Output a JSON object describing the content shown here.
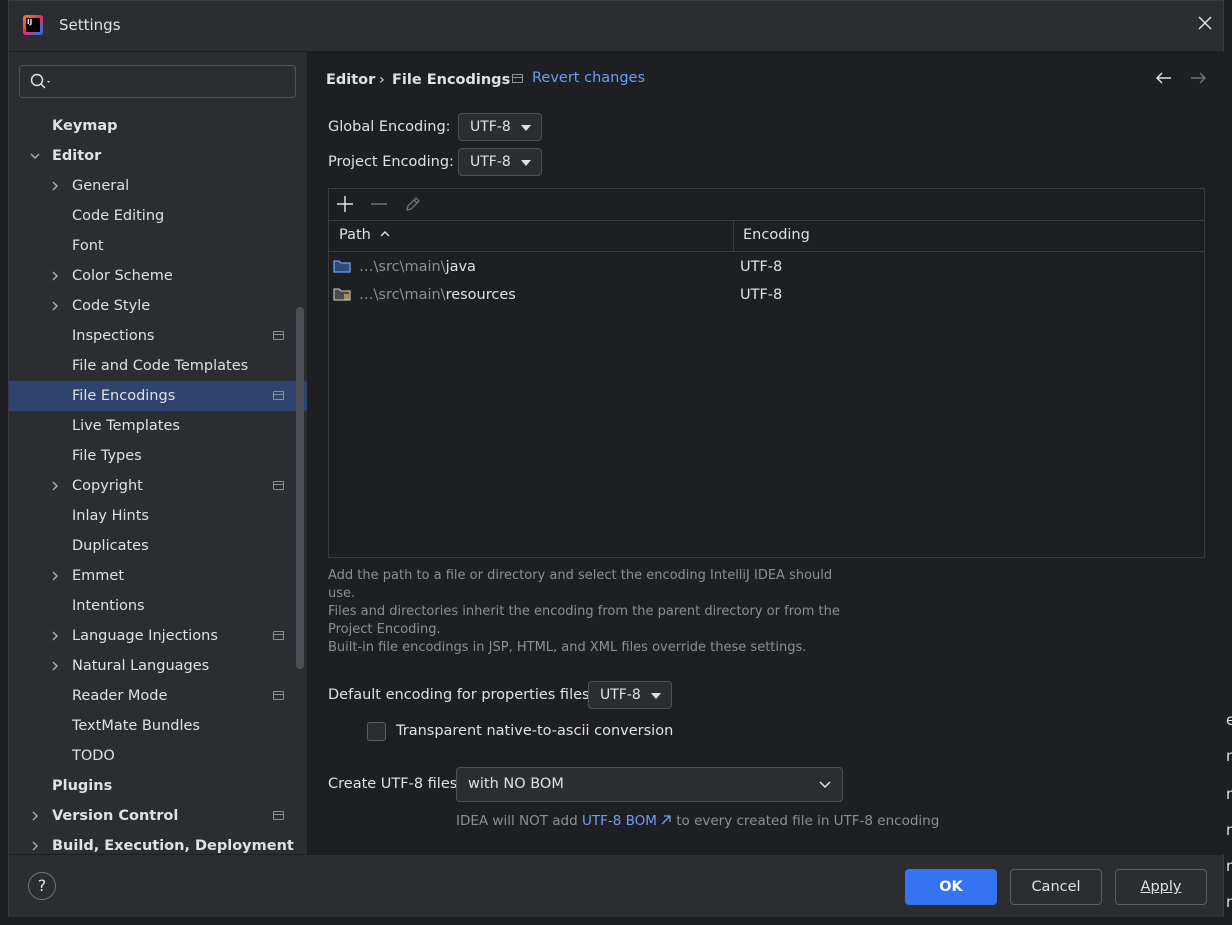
{
  "window": {
    "title": "Settings",
    "logo_text": "IJ"
  },
  "search": {
    "placeholder": ""
  },
  "sidebar": {
    "items": [
      {
        "label": "Keymap",
        "level": 0,
        "bold": true,
        "chevron": "none",
        "project": false
      },
      {
        "label": "Editor",
        "level": 0,
        "bold": true,
        "chevron": "down",
        "project": false
      },
      {
        "label": "General",
        "level": 1,
        "bold": false,
        "chevron": "right",
        "project": false
      },
      {
        "label": "Code Editing",
        "level": 1,
        "bold": false,
        "chevron": "none",
        "project": false
      },
      {
        "label": "Font",
        "level": 1,
        "bold": false,
        "chevron": "none",
        "project": false
      },
      {
        "label": "Color Scheme",
        "level": 1,
        "bold": false,
        "chevron": "right",
        "project": false
      },
      {
        "label": "Code Style",
        "level": 1,
        "bold": false,
        "chevron": "right",
        "project": false
      },
      {
        "label": "Inspections",
        "level": 1,
        "bold": false,
        "chevron": "none",
        "project": true
      },
      {
        "label": "File and Code Templates",
        "level": 1,
        "bold": false,
        "chevron": "none",
        "project": false
      },
      {
        "label": "File Encodings",
        "level": 1,
        "bold": false,
        "chevron": "none",
        "project": true,
        "selected": true
      },
      {
        "label": "Live Templates",
        "level": 1,
        "bold": false,
        "chevron": "none",
        "project": false
      },
      {
        "label": "File Types",
        "level": 1,
        "bold": false,
        "chevron": "none",
        "project": false
      },
      {
        "label": "Copyright",
        "level": 1,
        "bold": false,
        "chevron": "right",
        "project": true
      },
      {
        "label": "Inlay Hints",
        "level": 1,
        "bold": false,
        "chevron": "none",
        "project": false
      },
      {
        "label": "Duplicates",
        "level": 1,
        "bold": false,
        "chevron": "none",
        "project": false
      },
      {
        "label": "Emmet",
        "level": 1,
        "bold": false,
        "chevron": "right",
        "project": false
      },
      {
        "label": "Intentions",
        "level": 1,
        "bold": false,
        "chevron": "none",
        "project": false
      },
      {
        "label": "Language Injections",
        "level": 1,
        "bold": false,
        "chevron": "right",
        "project": true
      },
      {
        "label": "Natural Languages",
        "level": 1,
        "bold": false,
        "chevron": "right",
        "project": false
      },
      {
        "label": "Reader Mode",
        "level": 1,
        "bold": false,
        "chevron": "none",
        "project": true
      },
      {
        "label": "TextMate Bundles",
        "level": 1,
        "bold": false,
        "chevron": "none",
        "project": false
      },
      {
        "label": "TODO",
        "level": 1,
        "bold": false,
        "chevron": "none",
        "project": false
      },
      {
        "label": "Plugins",
        "level": 0,
        "bold": true,
        "chevron": "none",
        "project": false
      },
      {
        "label": "Version Control",
        "level": 0,
        "bold": true,
        "chevron": "right",
        "project": true
      },
      {
        "label": "Build, Execution, Deployment",
        "level": 0,
        "bold": true,
        "chevron": "right",
        "project": false
      }
    ]
  },
  "header": {
    "breadcrumb_parent": "Editor",
    "breadcrumb_sep": "›",
    "breadcrumb_current": "File Encodings",
    "revert_label": "Revert changes"
  },
  "encodings": {
    "global_label": "Global Encoding:",
    "global_value": "UTF-8",
    "project_label": "Project Encoding:",
    "project_value": "UTF-8"
  },
  "table": {
    "columns": [
      "Path",
      "Encoding"
    ],
    "rows": [
      {
        "path_prefix": "…\\src\\main\\",
        "path_name": "java",
        "encoding": "UTF-8",
        "icon": "folder-icon"
      },
      {
        "path_prefix": "…\\src\\main\\",
        "path_name": "resources",
        "encoding": "UTF-8",
        "icon": "resources-folder-icon"
      }
    ]
  },
  "hint_lines": [
    "Add the path to a file or directory and select the encoding IntelliJ IDEA should",
    "use.",
    "Files and directories inherit the encoding from the parent directory or from the",
    "Project Encoding.",
    "Built-in file encodings in JSP, HTML, and XML files override these settings."
  ],
  "properties": {
    "label": "Default encoding for properties files:",
    "value": "UTF-8",
    "checkbox_label": "Transparent native-to-ascii conversion",
    "checkbox_checked": false
  },
  "bom": {
    "label": "Create UTF-8 files:",
    "value": "with NO BOM",
    "hint_before": "IDEA will NOT add ",
    "hint_link": "UTF-8 BOM",
    "hint_after": " to every created file in UTF-8 encoding"
  },
  "buttons": {
    "ok": "OK",
    "cancel": "Cancel",
    "apply": "Apply",
    "help": "?"
  },
  "edge_chars": [
    "e",
    "n",
    "n",
    "n",
    "n",
    "n",
    "n"
  ],
  "colors": {
    "accent": "#3574f0",
    "link": "#6d9df7",
    "selection": "#2e436e",
    "panel": "#2b2d30",
    "content": "#1e1f22"
  }
}
